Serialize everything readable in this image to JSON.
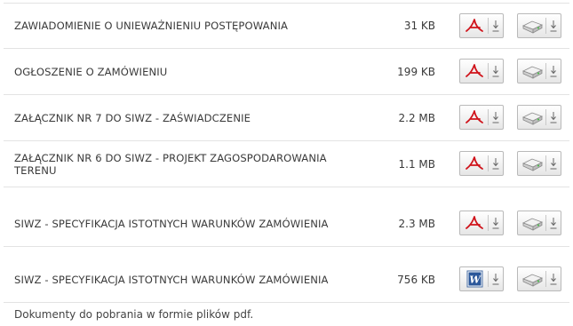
{
  "documents": [
    {
      "name": "ZAWIADOMIENIE O UNIEWAŻNIENIU POSTĘPOWANIA",
      "size": "31 KB",
      "type": "pdf"
    },
    {
      "name": "OGŁOSZENIE O ZAMÓWIENIU",
      "size": "199 KB",
      "type": "pdf"
    },
    {
      "name": "ZAŁĄCZNIK NR 7 DO SIWZ - ZAŚWIADCZENIE",
      "size": "2.2 MB",
      "type": "pdf"
    },
    {
      "name": "ZAŁĄCZNIK NR 6 DO SIWZ - PROJEKT ZAGOSPODAROWANIA TERENU",
      "size": "1.1 MB",
      "type": "pdf"
    },
    {
      "name": "SIWZ - SPECYFIKACJA ISTOTNYCH WARUNKÓW ZAMÓWIENIA",
      "size": "2.3 MB",
      "type": "pdf"
    },
    {
      "name": "SIWZ - SPECYFIKACJA ISTOTNYCH WARUNKÓW ZAMÓWIENIA",
      "size": "756 KB",
      "type": "word"
    }
  ],
  "icons": {
    "pdf": "pdf-icon",
    "word": "word-icon",
    "disk": "disk-drive-icon",
    "download": "download-arrow-icon"
  },
  "colors": {
    "pdf_red": "#d0141c",
    "word_blue": "#2b579a",
    "border": "#e3e3e3"
  },
  "footer": {
    "text": "Dokumenty do pobrania w formie plików pdf."
  }
}
